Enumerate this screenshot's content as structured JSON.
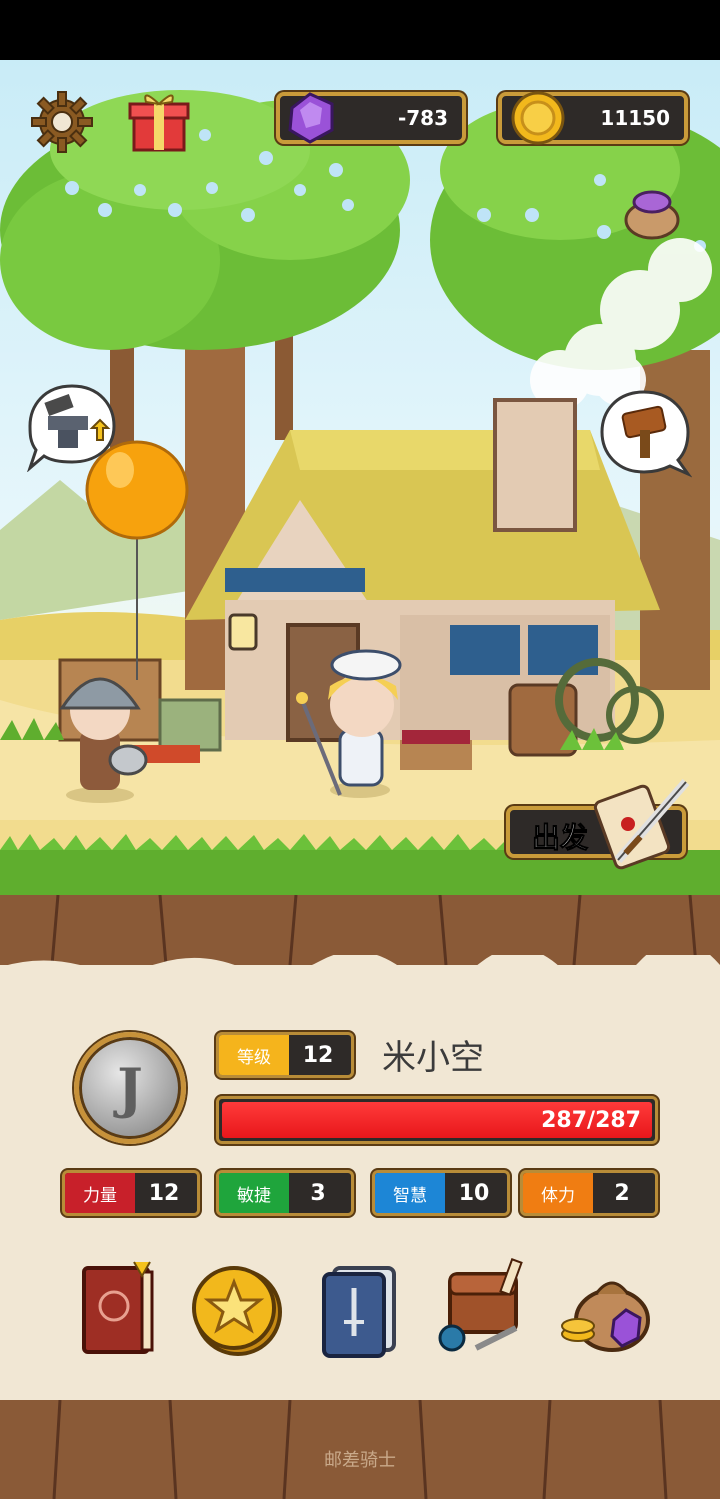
{
  "resources": {
    "gems": "-783",
    "coins": "11150"
  },
  "actions": {
    "go_label": "出发"
  },
  "character": {
    "avatar_letter": "J",
    "name": "米小空",
    "level_label": "等级",
    "level_value": "12",
    "hp_text": "287/287",
    "hp_fraction": 1.0
  },
  "stats": [
    {
      "label": "力量",
      "value": "12",
      "color": "#c8202a"
    },
    {
      "label": "敏捷",
      "value": "3",
      "color": "#1fa53c"
    },
    {
      "label": "智慧",
      "value": "10",
      "color": "#1d86d6"
    },
    {
      "label": "体力",
      "value": "2",
      "color": "#f07d12"
    }
  ],
  "menu_icons": [
    "journal-book-icon",
    "star-coin-icon",
    "sword-card-icon",
    "backpack-icon",
    "gem-sack-icon"
  ],
  "colors": {
    "level_label_bg": "#f5b41c",
    "hp_fill": "#e8171b",
    "frame_gold": "#c99b3a"
  },
  "footer": {
    "app_name": "邮差骑士"
  }
}
